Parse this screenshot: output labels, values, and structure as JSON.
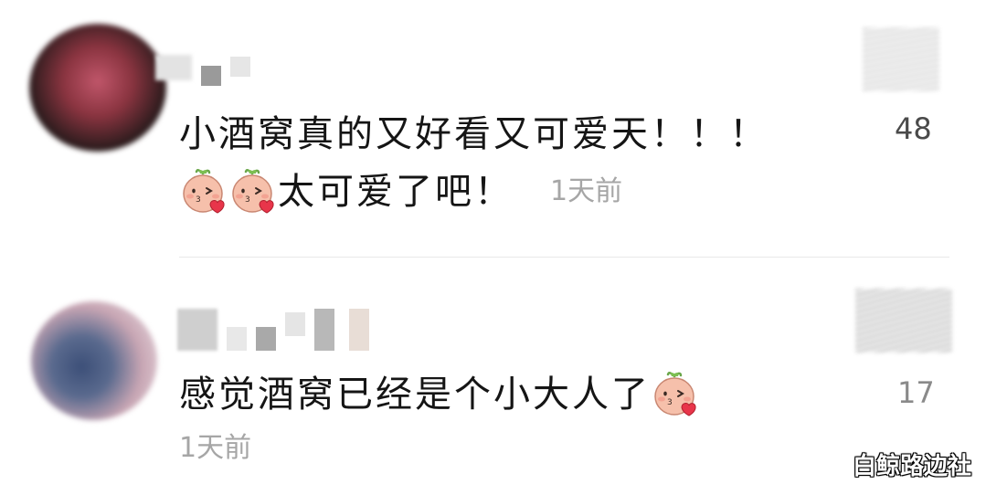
{
  "comments": [
    {
      "text": "小酒窝真的又好看又可爱天！！！",
      "emoji_line_text": "太可爱了吧！",
      "emojis": [
        "kiss-emoji",
        "kiss-emoji"
      ],
      "time": "1天前",
      "likes": "48"
    },
    {
      "text": "感觉酒窝已经是个小大人了",
      "emojis": [
        "kiss-emoji"
      ],
      "time": "1天前",
      "likes": "17"
    }
  ],
  "watermark": "白鲸路边社",
  "colors": {
    "text": "#151515",
    "time": "#a6a6a6",
    "like_count": "#4a4a4a",
    "divider": "#e8e8e8",
    "emoji_face": "#f6b8a4",
    "emoji_heart": "#e8354a"
  }
}
